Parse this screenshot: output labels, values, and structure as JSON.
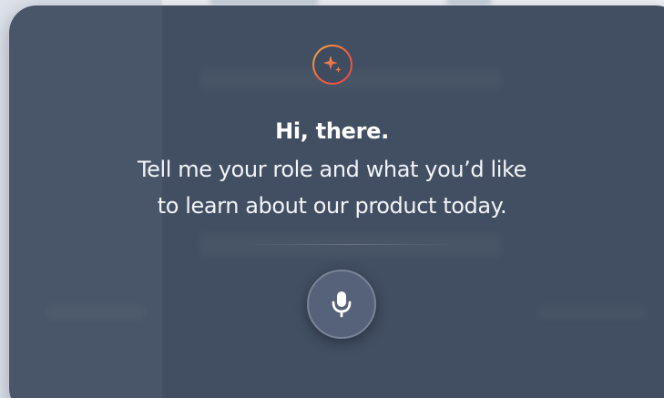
{
  "assistant": {
    "greeting_title": "Hi, there.",
    "prompt_line_1": "Tell me your role and what you’d like",
    "prompt_line_2": "to learn about our product today."
  },
  "icons": {
    "badge": "sparkles-icon",
    "mic": "microphone-icon"
  },
  "colors": {
    "overlay": "#344256",
    "badge_gradient_start": "#f7b04a",
    "badge_gradient_end": "#e8454c",
    "mic_button": "#56627a",
    "text": "#ffffff"
  }
}
